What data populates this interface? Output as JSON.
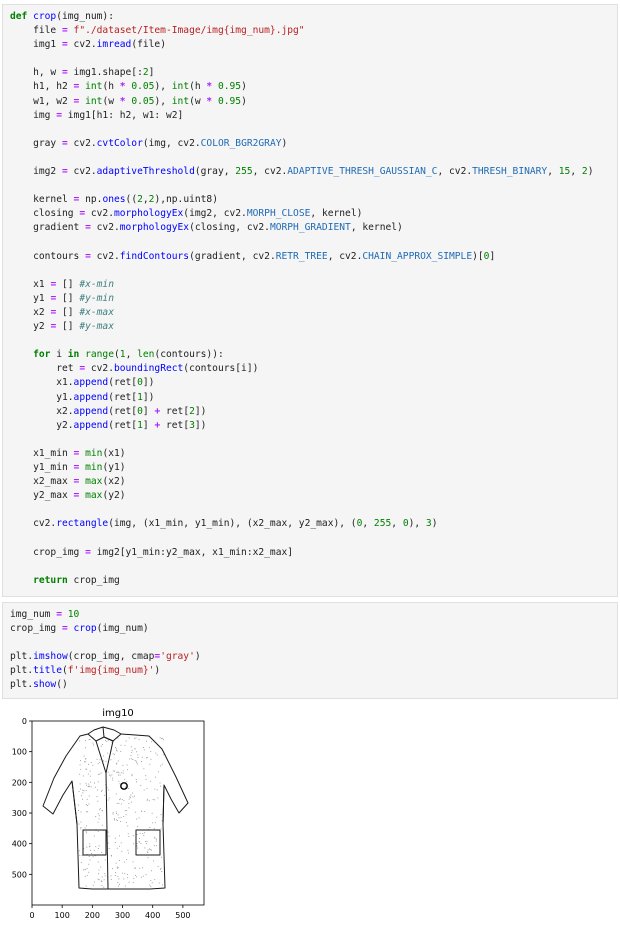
{
  "cell1": {
    "lines": [
      "def crop(img_num):",
      "    file = f\"./dataset/Item-Image/img{img_num}.jpg\"",
      "    img1 = cv2.imread(file)",
      "",
      "    h, w = img1.shape[:2]",
      "    h1, h2 = int(h * 0.05), int(h * 0.95)",
      "    w1, w2 = int(w * 0.05), int(w * 0.95)",
      "    img = img1[h1: h2, w1: w2]",
      "",
      "    gray = cv2.cvtColor(img, cv2.COLOR_BGR2GRAY)",
      "",
      "    img2 = cv2.adaptiveThreshold(gray, 255, cv2.ADAPTIVE_THRESH_GAUSSIAN_C, cv2.THRESH_BINARY, 15, 2)",
      "",
      "    kernel = np.ones((2,2),np.uint8)",
      "    closing = cv2.morphologyEx(img2, cv2.MORPH_CLOSE, kernel)",
      "    gradient = cv2.morphologyEx(closing, cv2.MORPH_GRADIENT, kernel)",
      "",
      "    contours = cv2.findContours(gradient, cv2.RETR_TREE, cv2.CHAIN_APPROX_SIMPLE)[0]",
      "",
      "    x1 = [] #x-min",
      "    y1 = [] #y-min",
      "    x2 = [] #x-max",
      "    y2 = [] #y-max",
      "",
      "    for i in range(1, len(contours)):",
      "        ret = cv2.boundingRect(contours[i])",
      "        x1.append(ret[0])",
      "        y1.append(ret[1])",
      "        x2.append(ret[0] + ret[2])",
      "        y2.append(ret[1] + ret[3])",
      "",
      "    x1_min = min(x1)",
      "    y1_min = min(y1)",
      "    x2_max = max(x2)",
      "    y2_max = max(y2)",
      "",
      "    cv2.rectangle(img, (x1_min, y1_min), (x2_max, y2_max), (0, 255, 0), 3)",
      "",
      "    crop_img = img2[y1_min:y2_max, x1_min:x2_max]",
      "",
      "    return crop_img"
    ]
  },
  "cell2": {
    "lines": [
      "img_num = 10",
      "crop_img = crop(img_num)",
      "",
      "plt.imshow(crop_img, cmap='gray')",
      "plt.title(f'img{img_num}')",
      "plt.show()"
    ]
  },
  "plot": {
    "title": "img10",
    "x_ticks": [
      "0",
      "100",
      "200",
      "300",
      "400",
      "500"
    ],
    "y_ticks": [
      "0",
      "100",
      "200",
      "300",
      "400",
      "500"
    ]
  }
}
